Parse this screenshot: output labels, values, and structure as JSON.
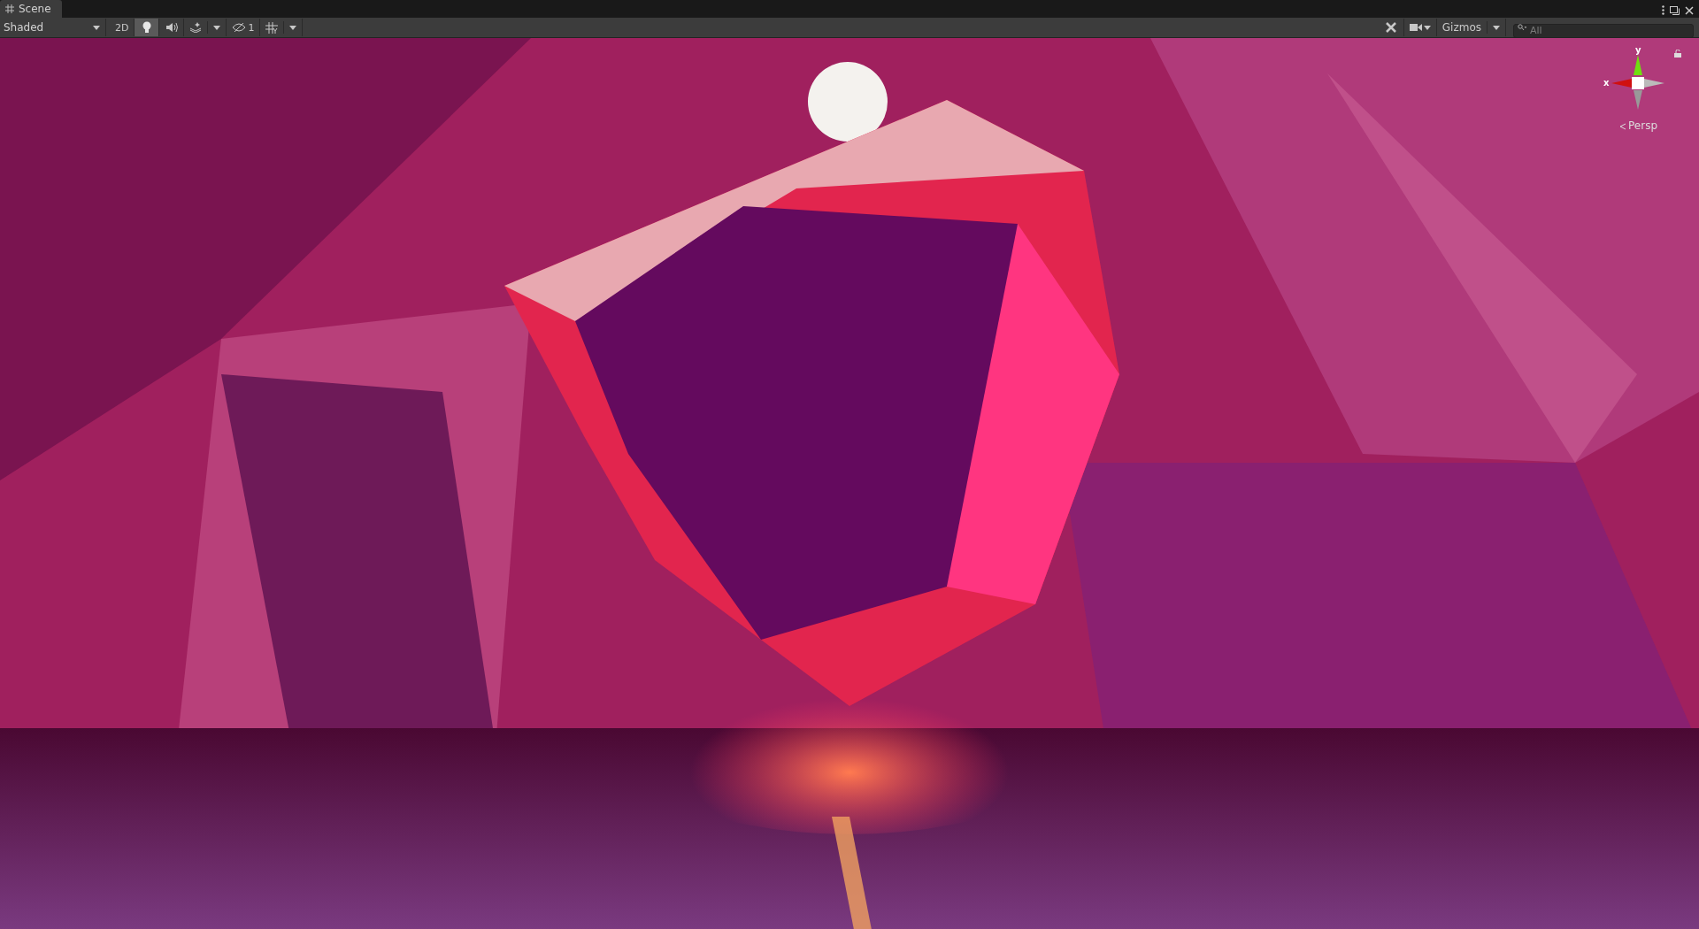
{
  "tabs": [
    {
      "label": "Scene",
      "selected": true
    }
  ],
  "toolbar": {
    "draw_mode": "Shaded",
    "buttons": [
      {
        "kind": "text",
        "label": "2D",
        "selected": false
      },
      {
        "kind": "light",
        "selected": true
      },
      {
        "kind": "audio",
        "selected": false
      },
      {
        "kind": "effects",
        "selected": false,
        "dropdown": true
      },
      {
        "kind": "hidden",
        "label": "1",
        "selected": false
      },
      {
        "kind": "grid",
        "selected": false,
        "dropdown": true
      }
    ]
  },
  "right_toolbar": {
    "gizmos_label": "Gizmos",
    "search": {
      "placeholder": "All"
    }
  },
  "gizmo": {
    "y_label": "y",
    "x_label": "x",
    "projection": "Persp"
  }
}
